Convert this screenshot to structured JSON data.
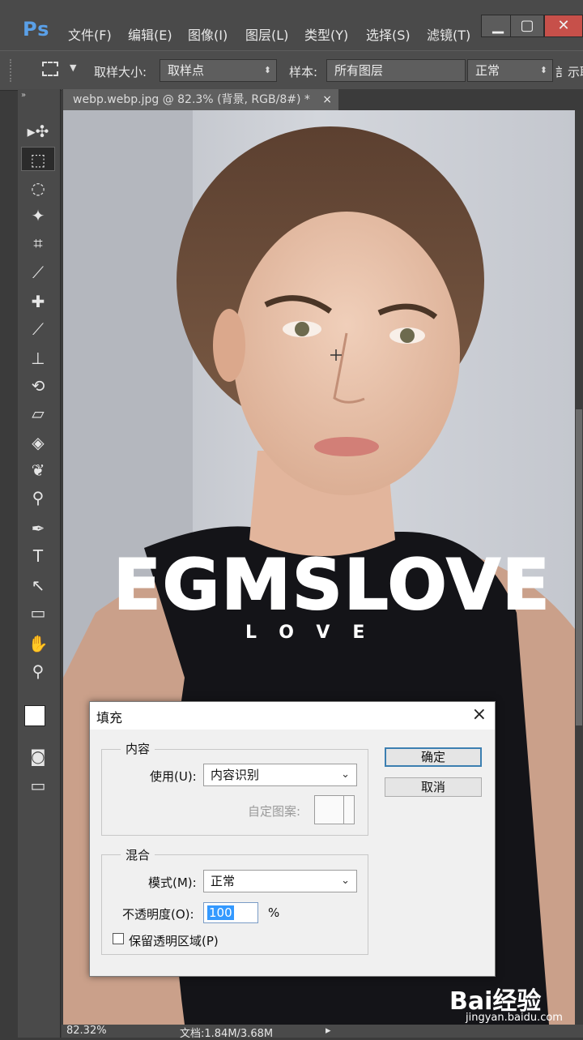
{
  "app": {
    "logo": "Ps"
  },
  "menu": [
    "文件(F)",
    "编辑(E)",
    "图像(I)",
    "图层(L)",
    "类型(Y)",
    "选择(S)",
    "滤镜(T)"
  ],
  "window_controls": [
    "minimize-icon",
    "maximize-icon",
    "close-icon"
  ],
  "options": {
    "sample_size_label": "取样大小:",
    "sample_size_value": "取样点",
    "sample_label": "样本:",
    "sample_value": "所有图层",
    "blend_value": "正常",
    "cut_text": "訁示取"
  },
  "document_tab": {
    "title": "webp.webp.jpg @ 82.3% (背景, RGB/8#) *",
    "close": "×"
  },
  "tools": [
    "move-icon",
    "rect-marquee-icon",
    "lasso-icon",
    "magic-wand-icon",
    "crop-icon",
    "eyedropper-icon",
    "healing-brush-icon",
    "brush-icon",
    "clone-stamp-icon",
    "history-brush-icon",
    "eraser-icon",
    "paint-bucket-icon",
    "smudge-icon",
    "dodge-icon",
    "pen-icon",
    "type-icon",
    "path-select-icon",
    "shape-icon",
    "hand-icon",
    "zoom-icon"
  ],
  "tool_glyphs": [
    "▸✣",
    "⬚",
    "◌",
    "✦",
    "⌗",
    "⟋",
    "✚",
    "⟋",
    "⊥",
    "⟲",
    "▱",
    "◈",
    "❦",
    "⚲",
    "✒",
    "T",
    "↖",
    "▭",
    "✋",
    "⚲"
  ],
  "canvas": {
    "watermark_big": "EGMSLOVE",
    "watermark_small": "LOVE"
  },
  "status": {
    "zoom": "82.32%",
    "doc": "文档:1.84M/3.68M"
  },
  "baidu": {
    "logo": "Bai经验",
    "url": "jingyan.baidu.com"
  },
  "dialog": {
    "title": "填充",
    "close": "×",
    "content_group": "内容",
    "use_label": "使用(U):",
    "use_value": "内容识别",
    "custom_pattern_label": "自定图案:",
    "blend_group": "混合",
    "mode_label": "模式(M):",
    "mode_value": "正常",
    "opacity_label": "不透明度(O):",
    "opacity_value": "100",
    "opacity_unit": "%",
    "preserve_label": "保留透明区域(P)",
    "ok": "确定",
    "cancel": "取消"
  }
}
